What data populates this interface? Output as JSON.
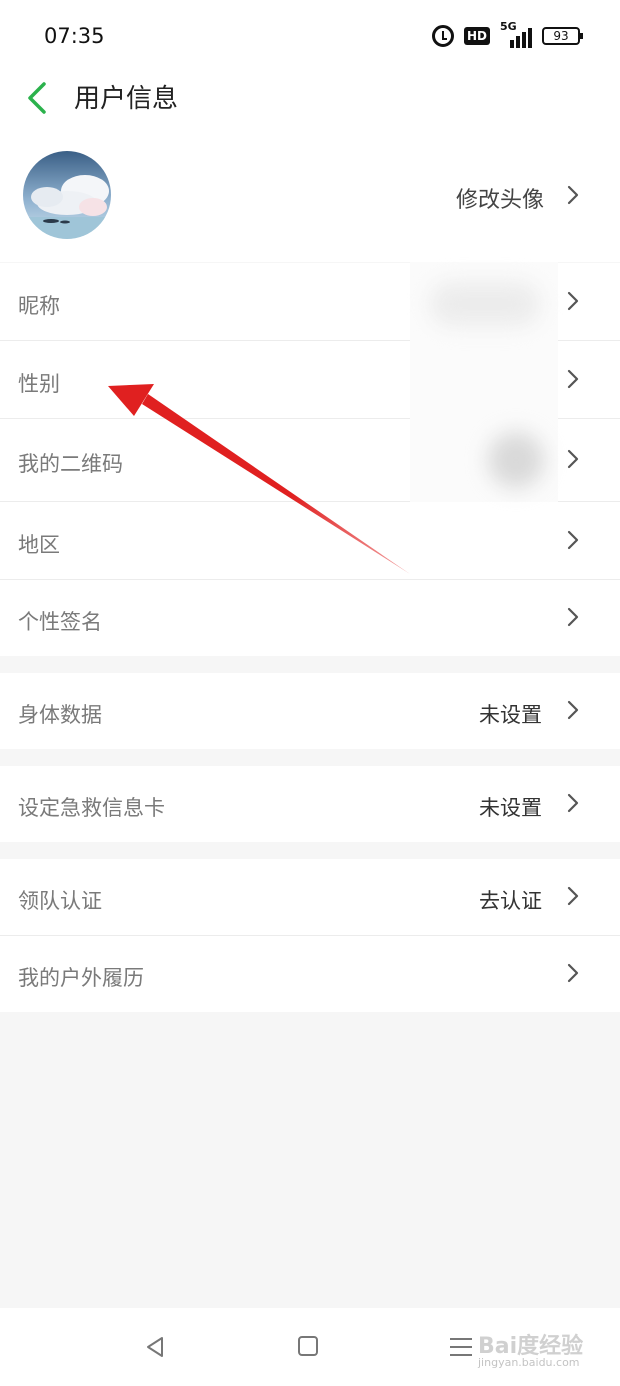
{
  "status_bar": {
    "time": "07:35",
    "network": "5G",
    "hd_label": "HD",
    "battery": "93"
  },
  "header": {
    "title": "用户信息",
    "back_icon": "chevron-left-icon",
    "accent_color": "#2bb24c"
  },
  "avatar_row": {
    "action_label": "修改头像"
  },
  "rows": [
    {
      "label": "昵称",
      "value": ""
    },
    {
      "label": "性别",
      "value": ""
    },
    {
      "label": "我的二维码",
      "value": ""
    },
    {
      "label": "地区",
      "value": ""
    },
    {
      "label": "个性签名",
      "value": ""
    },
    {
      "label": "身体数据",
      "value": "未设置"
    },
    {
      "label": "设定急救信息卡",
      "value": "未设置"
    },
    {
      "label": "领队认证",
      "value": "去认证"
    },
    {
      "label": "我的户外履历",
      "value": ""
    }
  ],
  "nav_bar": {
    "icons": [
      "back-triangle-icon",
      "home-square-icon",
      "menu-icon"
    ]
  },
  "watermark": {
    "brand": "Bai度经验",
    "url": "jingyan.baidu.com"
  },
  "annotation": {
    "color": "#e02020"
  }
}
